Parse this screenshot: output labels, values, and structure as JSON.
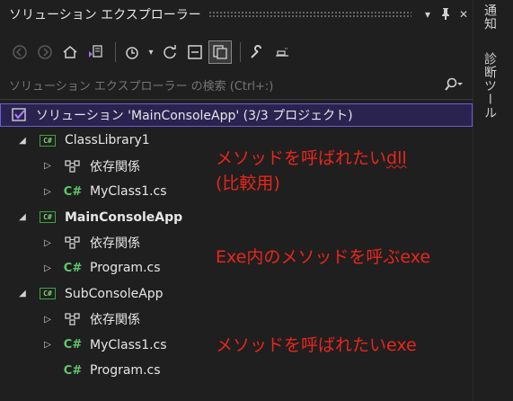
{
  "panel": {
    "title": "ソリューション エクスプローラー",
    "dropdown_glyph": "▾",
    "pin_glyph": "📌",
    "close_glyph": "✕"
  },
  "search": {
    "placeholder": "ソリューション エクスプローラー の検索 (Ctrl+:)"
  },
  "tree": [
    {
      "label": "ソリューション 'MainConsoleApp' (3/3 プロジェクト)",
      "type": "solution",
      "indent": 0,
      "expander": "",
      "selected": true
    },
    {
      "label": "ClassLibrary1",
      "type": "project",
      "indent": 1,
      "expander": "◢"
    },
    {
      "label": "依存関係",
      "type": "deps",
      "indent": 2,
      "expander": "▷"
    },
    {
      "label": "MyClass1.cs",
      "type": "cs",
      "indent": 2,
      "expander": "▷"
    },
    {
      "label": "MainConsoleApp",
      "type": "project",
      "indent": 1,
      "expander": "◢",
      "bold": true
    },
    {
      "label": "依存関係",
      "type": "deps",
      "indent": 2,
      "expander": "▷"
    },
    {
      "label": "Program.cs",
      "type": "cs",
      "indent": 2,
      "expander": "▷"
    },
    {
      "label": "SubConsoleApp",
      "type": "project",
      "indent": 1,
      "expander": "◢"
    },
    {
      "label": "依存関係",
      "type": "deps",
      "indent": 2,
      "expander": "▷"
    },
    {
      "label": "MyClass1.cs",
      "type": "cs",
      "indent": 2,
      "expander": "▷"
    },
    {
      "label": "Program.cs",
      "type": "cs",
      "indent": 2,
      "expander": ""
    }
  ],
  "annotations": {
    "a1_line1_prefix": "メソッドを呼ばれたい",
    "a1_line1_dll": "dll",
    "a1_line2": "(比較用)",
    "a2": "Exe内のメソッドを呼ぶexe",
    "a3": "メソッドを呼ばれたいexe"
  },
  "side_tabs": {
    "notifications": "通知",
    "diagnostics": "診断ツール"
  },
  "colors": {
    "background": "#1f1f1f",
    "selection": "#2a2350",
    "selection_border": "#6a5fd0",
    "annotation_red": "#e8261c",
    "csharp_green": "#5fc96a"
  }
}
